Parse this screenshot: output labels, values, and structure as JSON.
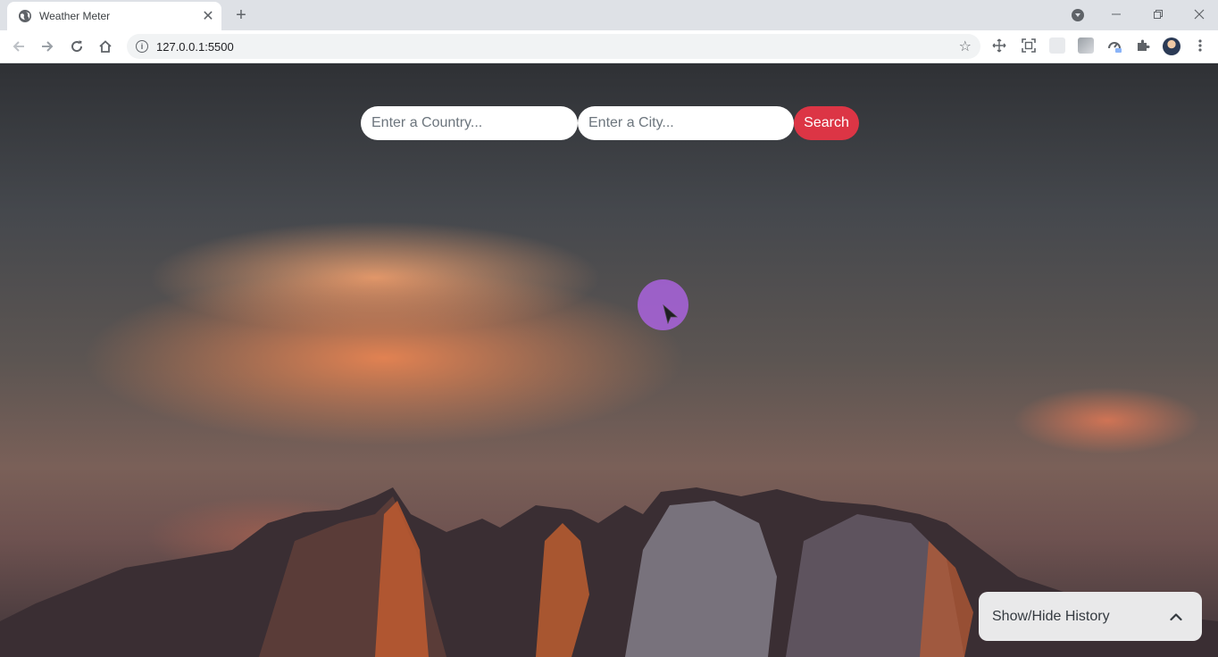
{
  "browser": {
    "tab_title": "Weather Meter",
    "tab_close_glyph": "✕",
    "new_tab_glyph": "+",
    "url": "127.0.0.1:5500",
    "icons": [
      "globe-icon",
      "close-icon",
      "plus-icon",
      "tab-search-icon",
      "minimize-icon",
      "restore-icon",
      "close-window-icon",
      "back-icon",
      "forward-icon",
      "reload-icon",
      "home-icon",
      "info-icon",
      "star-icon",
      "move-icon",
      "capture-icon",
      "extension-tile-icon",
      "extension-photo-icon",
      "speedometer-icon",
      "puzzle-icon",
      "avatar",
      "kebab-menu-icon"
    ]
  },
  "search": {
    "country_placeholder": "Enter a Country...",
    "city_placeholder": "Enter a City...",
    "button_label": "Search",
    "button_color": "#dc3545"
  },
  "history": {
    "toggle_label": "Show/Hide History",
    "chevron_icon": "chevron-up-icon"
  },
  "colors": {
    "cursor_highlight": "#af64e6"
  }
}
